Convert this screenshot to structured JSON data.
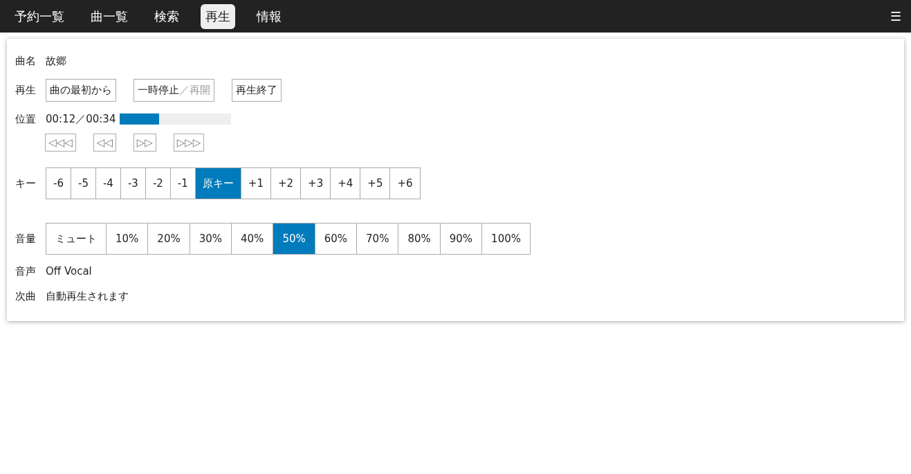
{
  "nav": {
    "tabs": [
      {
        "label": "予約一覧",
        "selected": false
      },
      {
        "label": "曲一覧",
        "selected": false
      },
      {
        "label": "検索",
        "selected": false
      },
      {
        "label": "再生",
        "selected": true
      },
      {
        "label": "情報",
        "selected": false
      }
    ],
    "menu_icon": "☰"
  },
  "song": {
    "label": "曲名",
    "value": "故郷"
  },
  "playback": {
    "label": "再生",
    "restart": "曲の最初から",
    "pause": {
      "active": "一時停止",
      "inactive": "／再開"
    },
    "stop": "再生終了"
  },
  "position": {
    "label": "位置",
    "time": "00:12／00:34",
    "level": 0.35,
    "seek": [
      "◁◁◁",
      "◁◁",
      "▷▷",
      "▷▷▷"
    ]
  },
  "key": {
    "label": "キー",
    "options": [
      {
        "label": "-6",
        "selected": false
      },
      {
        "label": "-5",
        "selected": false
      },
      {
        "label": "-4",
        "selected": false
      },
      {
        "label": "-3",
        "selected": false
      },
      {
        "label": "-2",
        "selected": false
      },
      {
        "label": "-1",
        "selected": false
      },
      {
        "label": "原キー",
        "selected": true
      },
      {
        "label": "+1",
        "selected": false
      },
      {
        "label": "+2",
        "selected": false
      },
      {
        "label": "+3",
        "selected": false
      },
      {
        "label": "+4",
        "selected": false
      },
      {
        "label": "+5",
        "selected": false
      },
      {
        "label": "+6",
        "selected": false
      }
    ]
  },
  "volume": {
    "label": "音量",
    "options": [
      {
        "label": "ミュート",
        "selected": false
      },
      {
        "label": "10%",
        "selected": false
      },
      {
        "label": "20%",
        "selected": false
      },
      {
        "label": "30%",
        "selected": false
      },
      {
        "label": "40%",
        "selected": false
      },
      {
        "label": "50%",
        "selected": true
      },
      {
        "label": "60%",
        "selected": false
      },
      {
        "label": "70%",
        "selected": false
      },
      {
        "label": "80%",
        "selected": false
      },
      {
        "label": "90%",
        "selected": false
      },
      {
        "label": "100%",
        "selected": false
      }
    ]
  },
  "voice": {
    "label": "音声",
    "value": "Off Vocal"
  },
  "next": {
    "label": "次曲",
    "value": "自動再生されます"
  }
}
